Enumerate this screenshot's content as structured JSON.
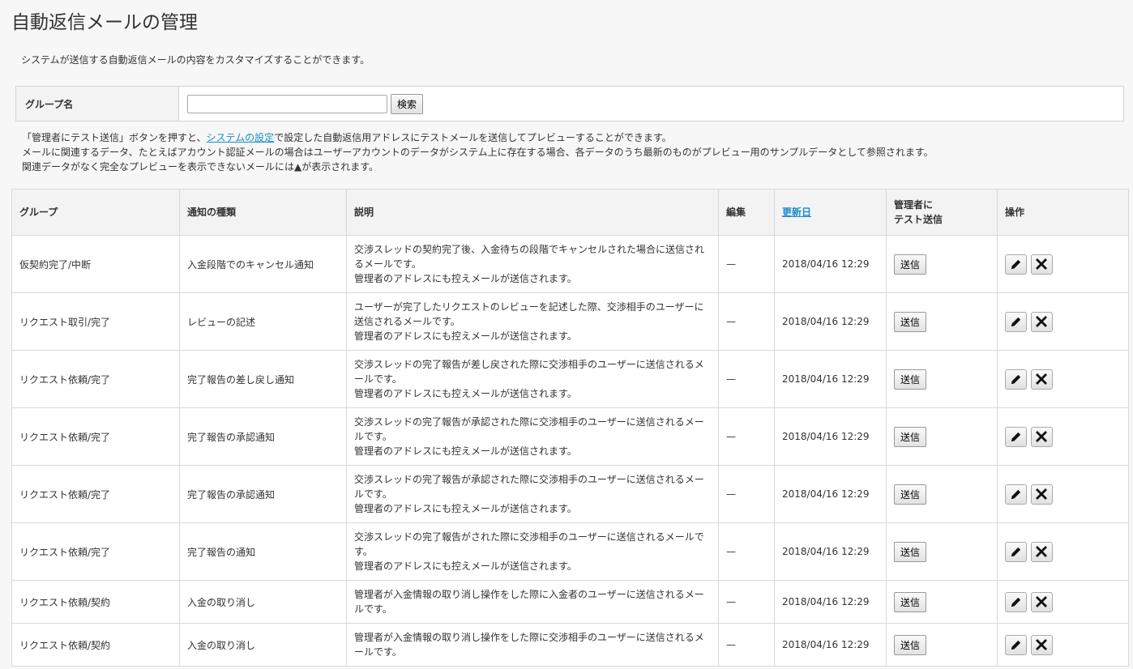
{
  "page": {
    "title": "自動返信メールの管理",
    "intro": "システムが送信する自動返信メールの内容をカスタマイズすることができます。"
  },
  "search": {
    "label": "グループ名",
    "value": "",
    "placeholder": "",
    "button": "検索"
  },
  "notes": {
    "line1_before": "「管理者にテスト送信」ボタンを押すと、",
    "line1_link": "システムの設定",
    "line1_after": "で設定した自動返信用アドレスにテストメールを送信してプレビューすることができます。",
    "line2": "メールに関連するデータ、たとえばアカウント認証メールの場合はユーザーアカウントのデータがシステム上に存在する場合、各データのうち最新のものがプレビュー用のサンプルデータとして参照されます。",
    "line3": "関連データがなく完全なプレビューを表示できないメールには▲が表示されます。"
  },
  "table": {
    "headers": {
      "group": "グループ",
      "type": "通知の種類",
      "description": "説明",
      "edit": "編集",
      "updated": "更新日",
      "test_line1": "管理者に",
      "test_line2": "テスト送信",
      "ops": "操作"
    },
    "send_label": "送信",
    "rows": [
      {
        "group": "仮契約完了/中断",
        "type": "入金段階でのキャンセル通知",
        "desc1": "交渉スレッドの契約完了後、入金待ちの段階でキャンセルされた場合に送信されるメールです。",
        "desc2": "管理者のアドレスにも控えメールが送信されます。",
        "edit": "—",
        "updated": "2018/04/16 12:29"
      },
      {
        "group": "リクエスト取引/完了",
        "type": "レビューの記述",
        "desc1": "ユーザーが完了したリクエストのレビューを記述した際、交渉相手のユーザーに送信されるメールです。",
        "desc2": "管理者のアドレスにも控えメールが送信されます。",
        "edit": "—",
        "updated": "2018/04/16 12:29"
      },
      {
        "group": "リクエスト依頼/完了",
        "type": "完了報告の差し戻し通知",
        "desc1": "交渉スレッドの完了報告が差し戻された際に交渉相手のユーザーに送信されるメールです。",
        "desc2": "管理者のアドレスにも控えメールが送信されます。",
        "edit": "—",
        "updated": "2018/04/16 12:29"
      },
      {
        "group": "リクエスト依頼/完了",
        "type": "完了報告の承認通知",
        "desc1": "交渉スレッドの完了報告が承認された際に交渉相手のユーザーに送信されるメールです。",
        "desc2": "管理者のアドレスにも控えメールが送信されます。",
        "edit": "—",
        "updated": "2018/04/16 12:29"
      },
      {
        "group": "リクエスト依頼/完了",
        "type": "完了報告の承認通知",
        "desc1": "交渉スレッドの完了報告が承認された際に交渉相手のユーザーに送信されるメールです。",
        "desc2": "管理者のアドレスにも控えメールが送信されます。",
        "edit": "—",
        "updated": "2018/04/16 12:29"
      },
      {
        "group": "リクエスト依頼/完了",
        "type": "完了報告の通知",
        "desc1": "交渉スレッドの完了報告がされた際に交渉相手のユーザーに送信されるメールです。",
        "desc2": "管理者のアドレスにも控えメールが送信されます。",
        "edit": "—",
        "updated": "2018/04/16 12:29"
      },
      {
        "group": "リクエスト依頼/契約",
        "type": "入金の取り消し",
        "desc1": "管理者が入金情報の取り消し操作をした際に入金者のユーザーに送信されるメールです。",
        "desc2": "",
        "edit": "—",
        "updated": "2018/04/16 12:29"
      },
      {
        "group": "リクエスト依頼/契約",
        "type": "入金の取り消し",
        "desc1": "管理者が入金情報の取り消し操作をした際に交渉相手のユーザーに送信されるメールです。",
        "desc2": "",
        "edit": "—",
        "updated": "2018/04/16 12:29"
      }
    ]
  },
  "icons": {
    "edit": "pencil-icon",
    "delete": "close-icon"
  }
}
